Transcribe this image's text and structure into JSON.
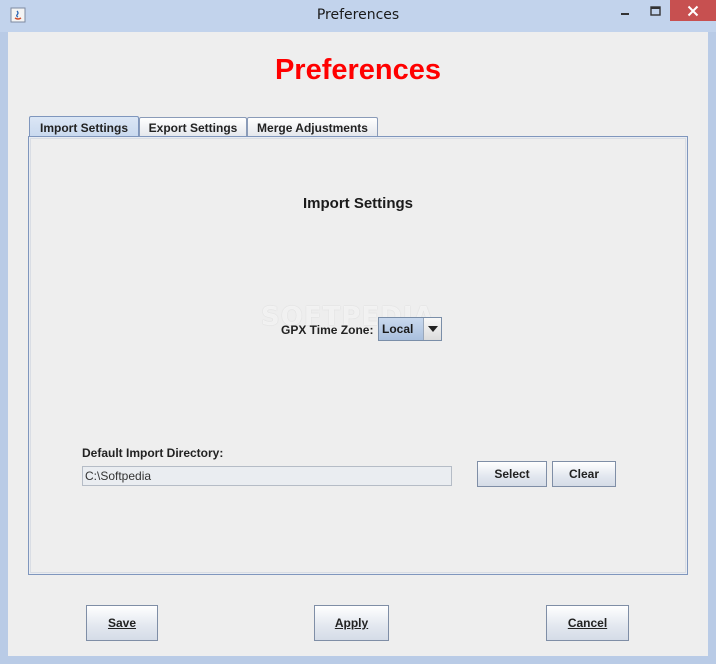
{
  "window": {
    "title": "Preferences",
    "controls": {
      "minimize": "minimize-icon",
      "maximize": "maximize-icon",
      "close": "close-icon"
    }
  },
  "heading": "Preferences",
  "tabs": [
    {
      "label": "Import Settings",
      "active": true
    },
    {
      "label": "Export Settings",
      "active": false
    },
    {
      "label": "Merge Adjustments",
      "active": false
    }
  ],
  "panel": {
    "title": "Import Settings",
    "watermark": "SOFTPEDIA",
    "gpx_time_zone": {
      "label": "GPX Time Zone:",
      "value": "Local"
    },
    "default_import_directory": {
      "label": "Default Import Directory:",
      "value": "C:\\Softpedia"
    },
    "select_label": "Select",
    "clear_label": "Clear"
  },
  "footer": {
    "save_label": "Save",
    "apply_label": "Apply",
    "cancel_label": "Cancel"
  },
  "colors": {
    "heading": "#ff0000",
    "titlebar": "#c2d3ec",
    "close_button": "#c75050"
  }
}
